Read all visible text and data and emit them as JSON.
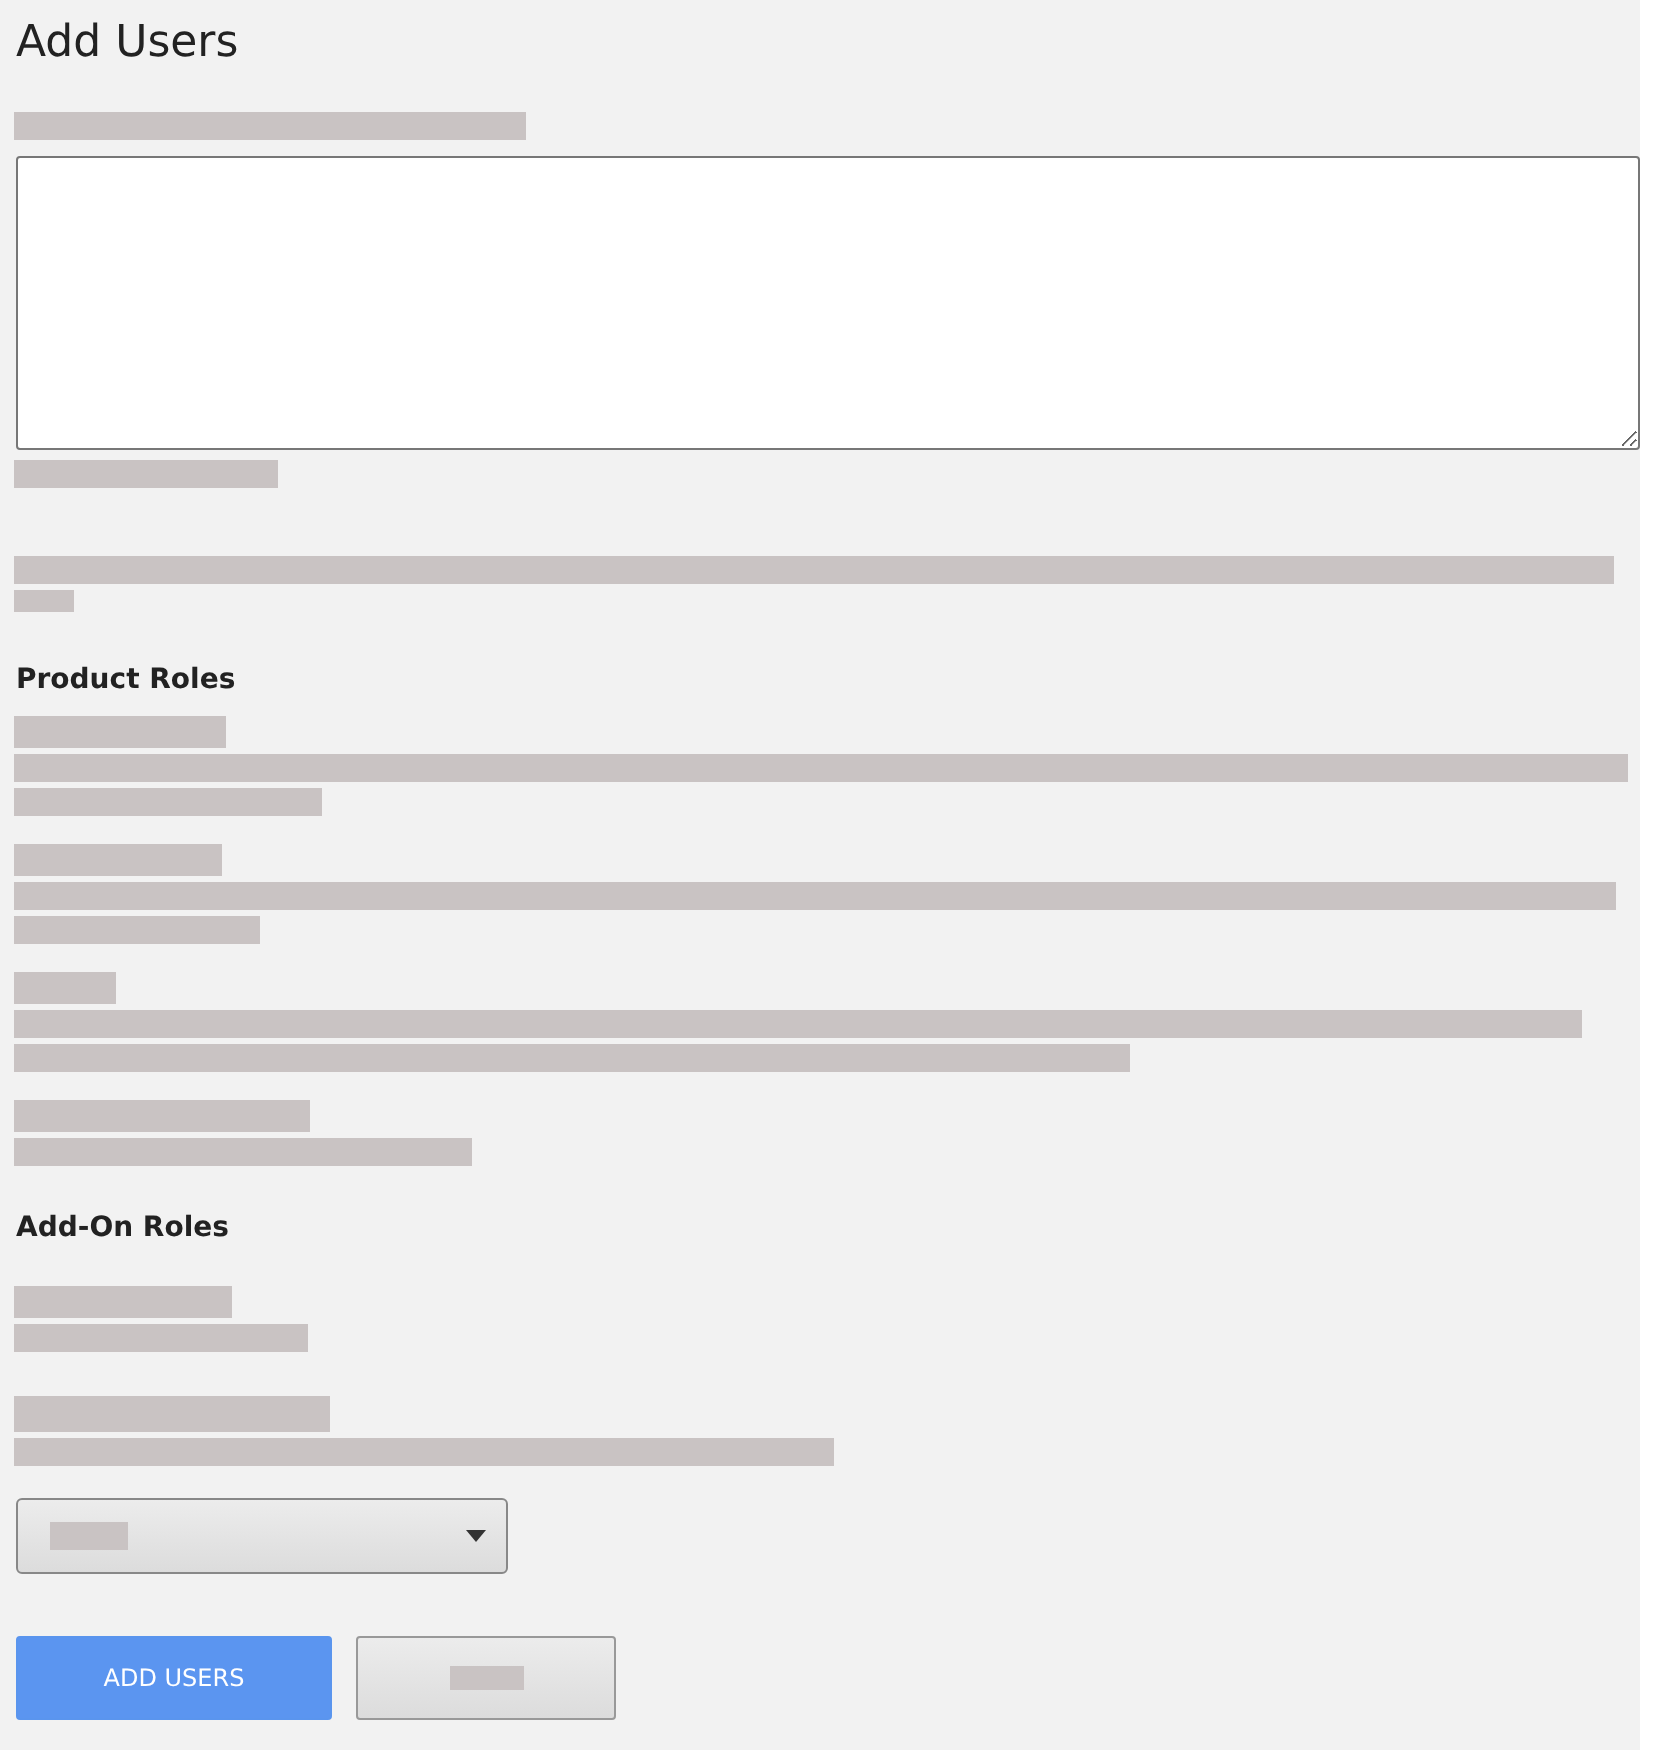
{
  "title": "Add Users",
  "emails": {
    "kind": "redacted"
  },
  "sections": [
    {
      "heading": "Product Roles",
      "roles": [
        {
          "kind": "redacted"
        },
        {
          "kind": "redacted"
        },
        {
          "kind": "redacted"
        },
        {
          "kind": "redacted"
        }
      ]
    },
    {
      "heading": "Add-On Roles",
      "roles": [
        {
          "kind": "redacted"
        },
        {
          "kind": "redacted"
        }
      ]
    }
  ],
  "dropdown": {
    "kind": "redacted"
  },
  "buttons": [
    {
      "kind": "primary",
      "label": "ADD USERS"
    },
    {
      "kind": "redacted"
    }
  ]
}
